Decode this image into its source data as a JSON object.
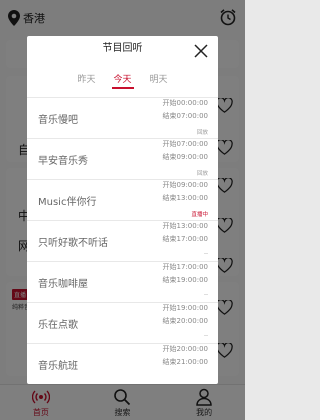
{
  "topbar": {
    "location": "香港"
  },
  "background": {
    "left_labels": [
      "自",
      "中",
      "网"
    ],
    "tag": "直播",
    "subtext": "纯粹音乐"
  },
  "nav": [
    {
      "label": "首页",
      "icon": "radio-icon",
      "active": true
    },
    {
      "label": "搜索",
      "icon": "search-icon",
      "active": false
    },
    {
      "label": "我的",
      "icon": "user-icon",
      "active": false
    }
  ],
  "modal": {
    "title": "节目回听",
    "tabs": [
      {
        "label": "昨天",
        "active": false
      },
      {
        "label": "今天",
        "active": true
      },
      {
        "label": "明天",
        "active": false
      }
    ],
    "programs": [
      {
        "name": "音乐慢吧",
        "status": "",
        "start": "开始00:00:00",
        "end": "结束07:00:00"
      },
      {
        "name": "早安音乐秀",
        "status": "回放",
        "start": "开始07:00:00",
        "end": "结束09:00:00"
      },
      {
        "name": "Music伴你行",
        "status": "回放",
        "start": "开始09:00:00",
        "end": "结束13:00:00"
      },
      {
        "name": "只听好歌不听话",
        "status": "直播中",
        "start": "开始13:00:00",
        "end": "结束17:00:00"
      },
      {
        "name": "音乐咖啡屋",
        "status": "--",
        "start": "开始17:00:00",
        "end": "结束19:00:00"
      },
      {
        "name": "乐在点歌",
        "status": "--",
        "start": "开始19:00:00",
        "end": "结束20:00:00"
      },
      {
        "name": "音乐航班",
        "status": "--",
        "start": "开始20:00:00",
        "end": "结束21:00:00"
      }
    ]
  },
  "colors": {
    "accent": "#c8102e",
    "overlay": "rgba(0,0,0,0.5)"
  }
}
